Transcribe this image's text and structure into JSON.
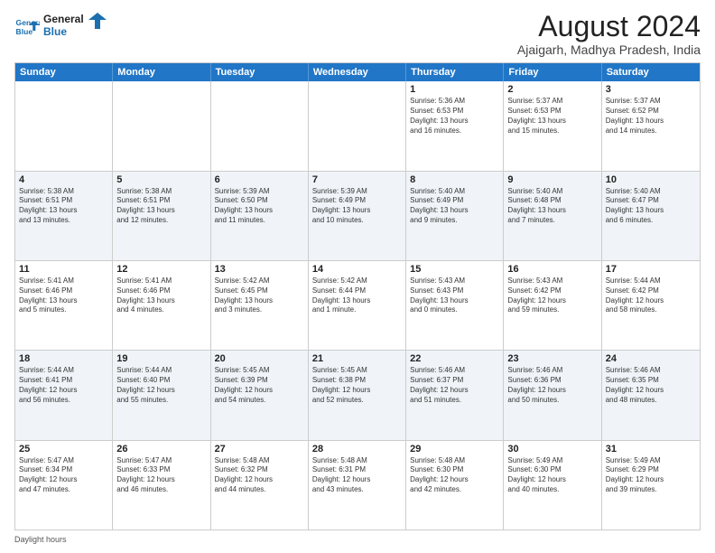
{
  "logo": {
    "line1": "General",
    "line2": "Blue"
  },
  "title": "August 2024",
  "subtitle": "Ajaigarh, Madhya Pradesh, India",
  "calendar": {
    "headers": [
      "Sunday",
      "Monday",
      "Tuesday",
      "Wednesday",
      "Thursday",
      "Friday",
      "Saturday"
    ],
    "weeks": [
      [
        {
          "day": "",
          "info": ""
        },
        {
          "day": "",
          "info": ""
        },
        {
          "day": "",
          "info": ""
        },
        {
          "day": "",
          "info": ""
        },
        {
          "day": "1",
          "info": "Sunrise: 5:36 AM\nSunset: 6:53 PM\nDaylight: 13 hours\nand 16 minutes."
        },
        {
          "day": "2",
          "info": "Sunrise: 5:37 AM\nSunset: 6:53 PM\nDaylight: 13 hours\nand 15 minutes."
        },
        {
          "day": "3",
          "info": "Sunrise: 5:37 AM\nSunset: 6:52 PM\nDaylight: 13 hours\nand 14 minutes."
        }
      ],
      [
        {
          "day": "4",
          "info": "Sunrise: 5:38 AM\nSunset: 6:51 PM\nDaylight: 13 hours\nand 13 minutes."
        },
        {
          "day": "5",
          "info": "Sunrise: 5:38 AM\nSunset: 6:51 PM\nDaylight: 13 hours\nand 12 minutes."
        },
        {
          "day": "6",
          "info": "Sunrise: 5:39 AM\nSunset: 6:50 PM\nDaylight: 13 hours\nand 11 minutes."
        },
        {
          "day": "7",
          "info": "Sunrise: 5:39 AM\nSunset: 6:49 PM\nDaylight: 13 hours\nand 10 minutes."
        },
        {
          "day": "8",
          "info": "Sunrise: 5:40 AM\nSunset: 6:49 PM\nDaylight: 13 hours\nand 9 minutes."
        },
        {
          "day": "9",
          "info": "Sunrise: 5:40 AM\nSunset: 6:48 PM\nDaylight: 13 hours\nand 7 minutes."
        },
        {
          "day": "10",
          "info": "Sunrise: 5:40 AM\nSunset: 6:47 PM\nDaylight: 13 hours\nand 6 minutes."
        }
      ],
      [
        {
          "day": "11",
          "info": "Sunrise: 5:41 AM\nSunset: 6:46 PM\nDaylight: 13 hours\nand 5 minutes."
        },
        {
          "day": "12",
          "info": "Sunrise: 5:41 AM\nSunset: 6:46 PM\nDaylight: 13 hours\nand 4 minutes."
        },
        {
          "day": "13",
          "info": "Sunrise: 5:42 AM\nSunset: 6:45 PM\nDaylight: 13 hours\nand 3 minutes."
        },
        {
          "day": "14",
          "info": "Sunrise: 5:42 AM\nSunset: 6:44 PM\nDaylight: 13 hours\nand 1 minute."
        },
        {
          "day": "15",
          "info": "Sunrise: 5:43 AM\nSunset: 6:43 PM\nDaylight: 13 hours\nand 0 minutes."
        },
        {
          "day": "16",
          "info": "Sunrise: 5:43 AM\nSunset: 6:42 PM\nDaylight: 12 hours\nand 59 minutes."
        },
        {
          "day": "17",
          "info": "Sunrise: 5:44 AM\nSunset: 6:42 PM\nDaylight: 12 hours\nand 58 minutes."
        }
      ],
      [
        {
          "day": "18",
          "info": "Sunrise: 5:44 AM\nSunset: 6:41 PM\nDaylight: 12 hours\nand 56 minutes."
        },
        {
          "day": "19",
          "info": "Sunrise: 5:44 AM\nSunset: 6:40 PM\nDaylight: 12 hours\nand 55 minutes."
        },
        {
          "day": "20",
          "info": "Sunrise: 5:45 AM\nSunset: 6:39 PM\nDaylight: 12 hours\nand 54 minutes."
        },
        {
          "day": "21",
          "info": "Sunrise: 5:45 AM\nSunset: 6:38 PM\nDaylight: 12 hours\nand 52 minutes."
        },
        {
          "day": "22",
          "info": "Sunrise: 5:46 AM\nSunset: 6:37 PM\nDaylight: 12 hours\nand 51 minutes."
        },
        {
          "day": "23",
          "info": "Sunrise: 5:46 AM\nSunset: 6:36 PM\nDaylight: 12 hours\nand 50 minutes."
        },
        {
          "day": "24",
          "info": "Sunrise: 5:46 AM\nSunset: 6:35 PM\nDaylight: 12 hours\nand 48 minutes."
        }
      ],
      [
        {
          "day": "25",
          "info": "Sunrise: 5:47 AM\nSunset: 6:34 PM\nDaylight: 12 hours\nand 47 minutes."
        },
        {
          "day": "26",
          "info": "Sunrise: 5:47 AM\nSunset: 6:33 PM\nDaylight: 12 hours\nand 46 minutes."
        },
        {
          "day": "27",
          "info": "Sunrise: 5:48 AM\nSunset: 6:32 PM\nDaylight: 12 hours\nand 44 minutes."
        },
        {
          "day": "28",
          "info": "Sunrise: 5:48 AM\nSunset: 6:31 PM\nDaylight: 12 hours\nand 43 minutes."
        },
        {
          "day": "29",
          "info": "Sunrise: 5:48 AM\nSunset: 6:30 PM\nDaylight: 12 hours\nand 42 minutes."
        },
        {
          "day": "30",
          "info": "Sunrise: 5:49 AM\nSunset: 6:30 PM\nDaylight: 12 hours\nand 40 minutes."
        },
        {
          "day": "31",
          "info": "Sunrise: 5:49 AM\nSunset: 6:29 PM\nDaylight: 12 hours\nand 39 minutes."
        }
      ]
    ]
  },
  "legend": {
    "daylight_hours": "Daylight hours"
  }
}
